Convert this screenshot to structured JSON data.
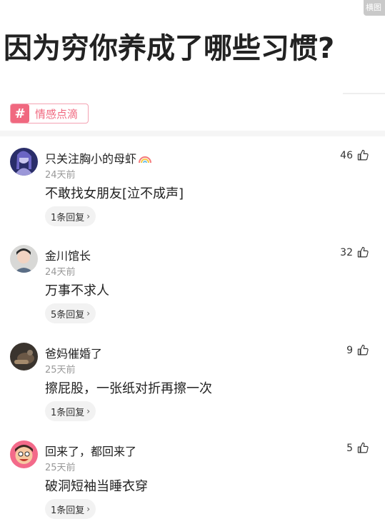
{
  "corner_badge": "横图",
  "question_title": "因为穷你养成了哪些习惯?",
  "topic": {
    "icon": "hash-icon",
    "label": "情感点滴",
    "color": "#f0687f"
  },
  "comments": [
    {
      "author": "只关注胸小的母虾",
      "time": "24天前",
      "text": "不敢找女朋友[泣不成声]",
      "replies": "1条回复",
      "likes": "46"
    },
    {
      "author": "金川馆长",
      "time": "24天前",
      "text": "万事不求人",
      "replies": "5条回复",
      "likes": "32"
    },
    {
      "author": "爸妈催婚了",
      "time": "25天前",
      "text": "擦屁股，一张纸对折再擦一次",
      "replies": "1条回复",
      "likes": "9"
    },
    {
      "author": "回来了，都回来了",
      "time": "25天前",
      "text": "破洞短袖当睡衣穿",
      "replies": "1条回复",
      "likes": "5"
    }
  ]
}
